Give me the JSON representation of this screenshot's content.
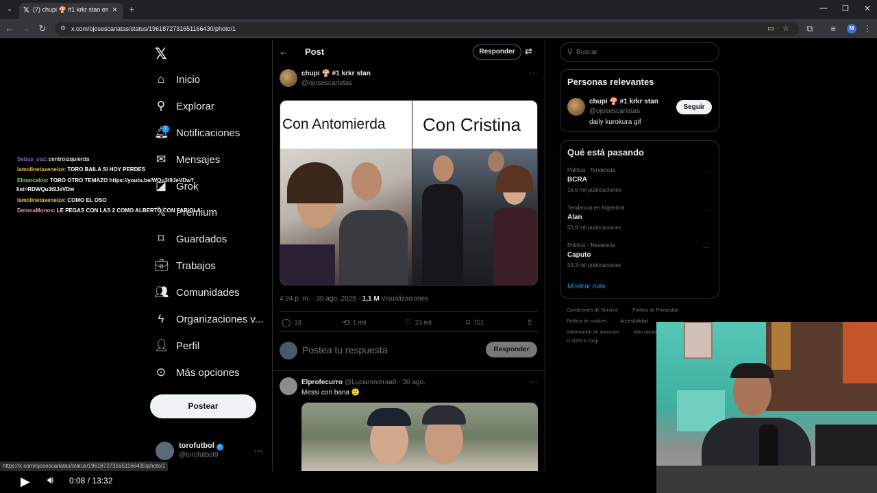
{
  "browser": {
    "tab_title": "(7) chupi 🍄 #1 krkr stan en X:",
    "url": "x.com/ojosescarlatas/status/1961872731651166430/photo/1",
    "profile_initial": "M"
  },
  "sidebar": {
    "items": [
      {
        "label": "Inicio",
        "icon": "home-icon"
      },
      {
        "label": "Explorar",
        "icon": "search-icon"
      },
      {
        "label": "Notificaciones",
        "icon": "bell-icon",
        "badge": "7"
      },
      {
        "label": "Mensajes",
        "icon": "mail-icon"
      },
      {
        "label": "Grok",
        "icon": "grok-icon"
      },
      {
        "label": "Premium",
        "icon": "x-premium-icon"
      },
      {
        "label": "Guardados",
        "icon": "bookmark-icon"
      },
      {
        "label": "Trabajos",
        "icon": "briefcase-icon"
      },
      {
        "label": "Comunidades",
        "icon": "people-icon"
      },
      {
        "label": "Organizaciones v...",
        "icon": "lightning-icon"
      },
      {
        "label": "Perfil",
        "icon": "person-icon"
      },
      {
        "label": "Más opciones",
        "icon": "more-circle-icon"
      }
    ],
    "post_button": "Postear",
    "account": {
      "name": "torofutbol",
      "handle": "@torofutbol9"
    }
  },
  "chat": [
    {
      "user": "Sebas_ssz",
      "msg": ": centroizquierda",
      "color": "#8a5cc4"
    },
    {
      "user": "lamolinetaxeneize",
      "msg": ": TORO BAILA SI HOY PERDES",
      "color": "#f0c040"
    },
    {
      "user": "Elmarceloo",
      "msg": ": TORO OTRO TEMAZO https://youtu.be/WQu3t9JeVDw?",
      "color": "#7ee05a"
    },
    {
      "user": "",
      "msg": "list=RDWQu3t9JeVDw",
      "color": "#ffffff"
    },
    {
      "user": "lamolinetaxeneize",
      "msg": ": COMO EL OSO",
      "color": "#f0c040"
    },
    {
      "user": "DetonaMonos",
      "msg": ": LE PEGAS CON LAS 2 COMO ALBERTO CON FABIOLA",
      "color": "#ff8fc4"
    }
  ],
  "post": {
    "header_title": "Post",
    "reply_pill": "Responder",
    "author_name": "chupi 🍄 #1 krkr stan",
    "author_handle": "@ojosescarlatas",
    "meme_left": "Con Antomierda",
    "meme_right": "Con Cristina",
    "timestamp": "4:24 p. m. · 30 ago. 2025 · ",
    "views_count": "1,1 M",
    "views_label": " Visualizaciones",
    "replies": "33",
    "reposts": "1 mil",
    "likes": "23 mil",
    "bookmarks": "751",
    "reply_placeholder": "Postea tu respuesta",
    "reply_button": "Responder"
  },
  "reply": {
    "name": "Elprofecurro",
    "handle_date": "@Lucianoveraa0 · 30 ago.",
    "text": "Messi con bana 🙂"
  },
  "right": {
    "search_placeholder": "Buscar",
    "relevant_title": "Personas relevantes",
    "relevant": {
      "name": "chupi 🍄 #1 krkr stan",
      "handle": "@ojosescarlatas",
      "bio": "daily kurokura gif",
      "follow": "Seguir"
    },
    "trending_title": "Qué está pasando",
    "trends": [
      {
        "category": "Política · Tendencia",
        "name": "BCRA",
        "count": "16,6 mil publicaciones"
      },
      {
        "category": "Tendencia en Argentina",
        "name": "Alan",
        "count": "55,9 mil publicaciones"
      },
      {
        "category": "Política · Tendencia",
        "name": "Caputo",
        "count": "53,3 mil publicaciones"
      }
    ],
    "show_more": "Mostrar más",
    "footer": [
      "Condiciones de Servicio",
      "Política de Privacidad",
      "Política de cookies",
      "Accesibilidad",
      "Información de anuncios",
      "Más opciones",
      "© 2025 X Corp."
    ]
  },
  "player": {
    "status_url": "https://x.com/ojosescarlatas/status/1961872731651166430/photo/1",
    "time": "0:08 / 13:32"
  }
}
